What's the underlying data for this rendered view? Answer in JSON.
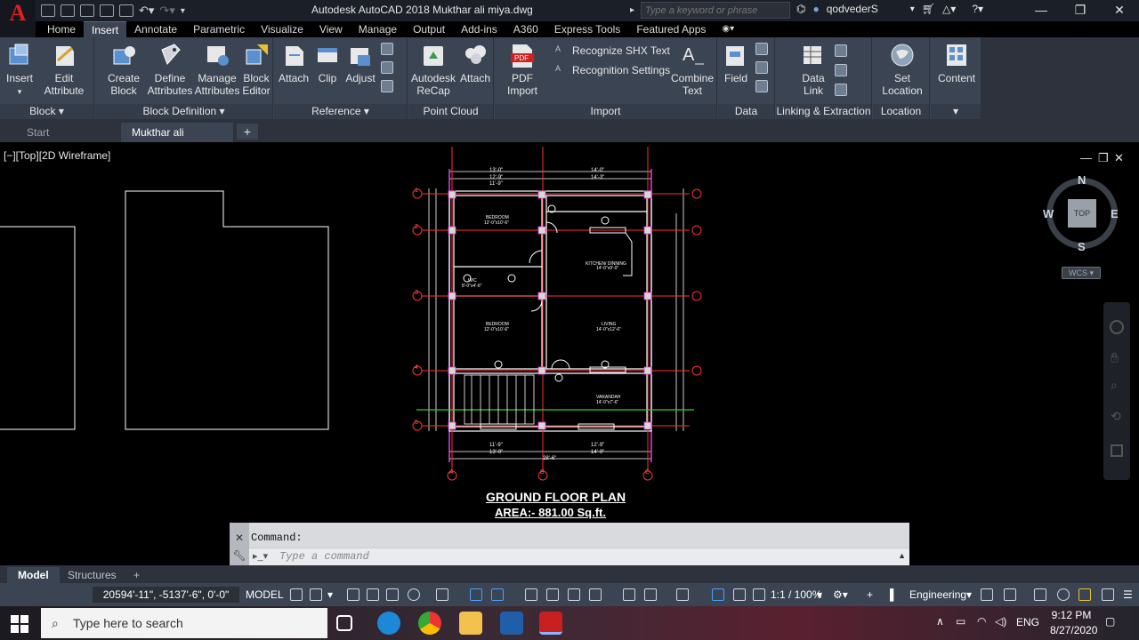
{
  "window": {
    "title": "Autodesk AutoCAD 2018    Mukthar ali miya.dwg",
    "logo_letter": "A",
    "search_placeholder": "Type a keyword or phrase",
    "username": "qodvederS",
    "controls": [
      "—",
      "❐",
      "✕"
    ]
  },
  "ribbon_tabs": [
    "Home",
    "Insert",
    "Annotate",
    "Parametric",
    "Visualize",
    "View",
    "Manage",
    "Output",
    "Add-ins",
    "A360",
    "Express Tools",
    "Featured Apps"
  ],
  "active_tab": "Insert",
  "ribbon": {
    "block": {
      "title": "Block ▾",
      "insert": "Insert",
      "edit_attribute": "Edit\nAttribute"
    },
    "block_definition": {
      "title": "Block Definition ▾",
      "create_block": "Create\nBlock",
      "define_attributes": "Define\nAttributes",
      "manage_attributes": "Manage\nAttributes",
      "block_editor": "Block\nEditor"
    },
    "reference": {
      "title": "Reference ▾",
      "attach": "Attach",
      "clip": "Clip",
      "adjust": "Adjust"
    },
    "point_cloud": {
      "title": "Point Cloud",
      "recap": "Autodesk\nReCap",
      "attach": "Attach"
    },
    "import": {
      "title": "Import",
      "pdf_import": "PDF\nImport",
      "recognize_shx": "Recognize SHX Text",
      "recognition_settings": "Recognition Settings",
      "combine_text": "Combine\nText"
    },
    "data": {
      "title": "Data",
      "field": "Field"
    },
    "linking": {
      "title": "Linking & Extraction",
      "data_link": "Data\nLink"
    },
    "location": {
      "title": "Location",
      "set_location": "Set\nLocation"
    },
    "content": {
      "title": "",
      "content": "Content"
    }
  },
  "file_tabs": {
    "start": "Start",
    "active": "Mukthar ali miya*",
    "close": "✕",
    "add": "+"
  },
  "viewport": {
    "label": "[−][Top][2D Wireframe]",
    "viewcube": {
      "n": "N",
      "s": "S",
      "e": "E",
      "w": "W",
      "face": "TOP",
      "wcs": "WCS ▾"
    },
    "plan_title": "GROUND FLOOR PLAN",
    "plan_area": "AREA:- 881.00 Sq.ft.",
    "rooms": {
      "bedroom1": "BEDROOM",
      "bedroom1_size": "12'-0\"x10'-6\"",
      "kitchen": "KITCHEN/ DINNING",
      "kitchen_size": "14'-0\"x9'-0\"",
      "wc": "W/C",
      "wc_size": "8'-0\"x4'-6\"",
      "bedroom2": "BEDROOM",
      "bedroom2_size": "12'-0\"x10'-6\"",
      "living": "LIVING",
      "living_size": "14'-0\"x12'-6\"",
      "varandah": "VARANDAH",
      "varandah_size": "14'-0\"x7'-6\""
    },
    "grid_rows": [
      "1",
      "2",
      "3",
      "4",
      "5"
    ],
    "grid_cols": [
      "A",
      "B",
      "C"
    ],
    "dims_top": [
      "13'-0\"",
      "14'-0\"",
      "12'-9\"",
      "14'-3\"",
      "11'-9\""
    ],
    "dims_bottom": [
      "11'-9\"",
      "13'-0\"",
      "12'-9\"",
      "14'-0\"",
      "28'-6\""
    ]
  },
  "command": {
    "history": "Command:",
    "placeholder": "Type a command"
  },
  "layout_tabs": [
    "Model",
    "Structures",
    "+"
  ],
  "status": {
    "coords": "20594'-11\", -5137'-6\", 0'-0\"",
    "model": "MODEL",
    "scale": "1:1 / 100%",
    "workspace": "Engineering"
  },
  "taskbar": {
    "search": "Type here to search",
    "lang": "ENG",
    "time": "9:12 PM",
    "date": "8/27/2020"
  }
}
